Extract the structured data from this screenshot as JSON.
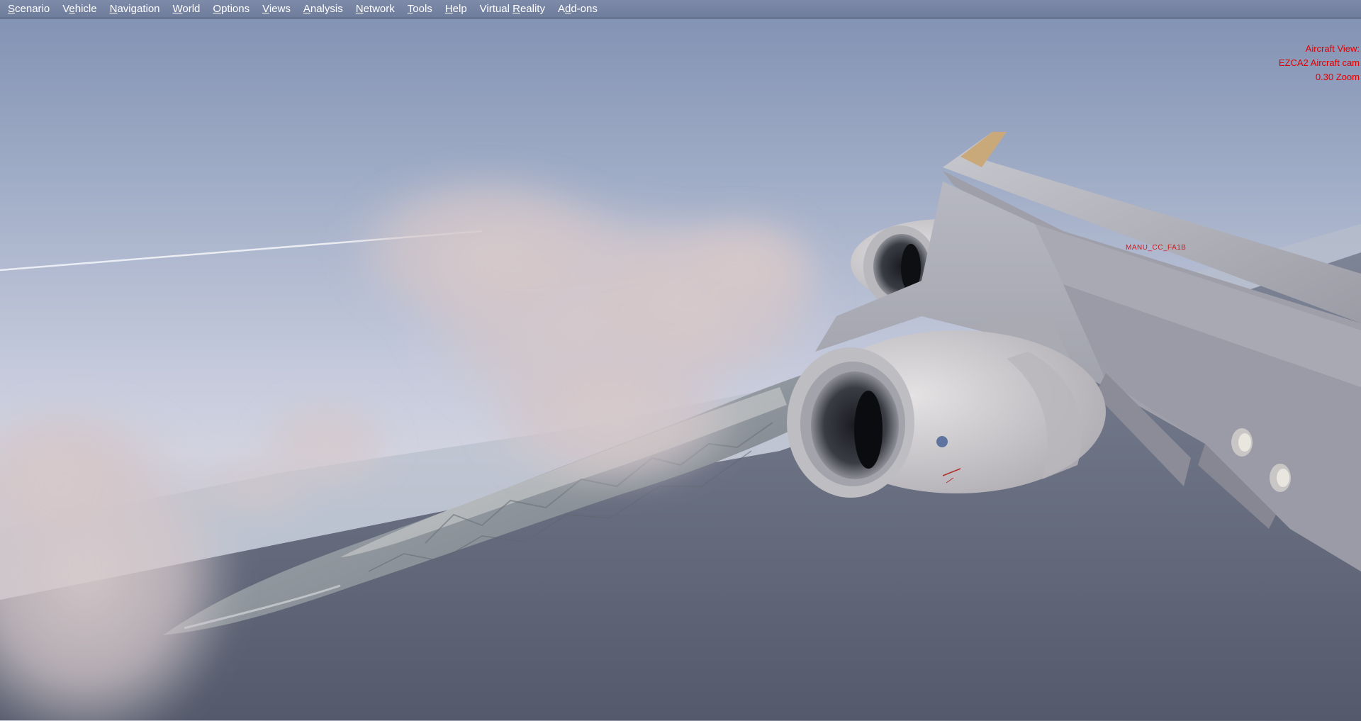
{
  "menu": {
    "items": [
      {
        "name": "scenario",
        "u": "S",
        "rest": "cenario"
      },
      {
        "name": "vehicle",
        "pre": "V",
        "u": "e",
        "rest": "hicle"
      },
      {
        "name": "navigation",
        "u": "N",
        "rest": "avigation"
      },
      {
        "name": "world",
        "u": "W",
        "rest": "orld"
      },
      {
        "name": "options",
        "u": "O",
        "rest": "ptions"
      },
      {
        "name": "views",
        "u": "V",
        "rest": "iews"
      },
      {
        "name": "analysis",
        "u": "A",
        "rest": "nalysis"
      },
      {
        "name": "network",
        "u": "N",
        "rest": "etwork"
      },
      {
        "name": "tools",
        "u": "T",
        "rest": "ools"
      },
      {
        "name": "help",
        "u": "H",
        "rest": "elp"
      },
      {
        "name": "virtual-reality",
        "pre": "Virtual ",
        "u": "R",
        "rest": "eality"
      },
      {
        "name": "add-ons",
        "pre": "A",
        "u": "d",
        "rest": "d-ons"
      }
    ]
  },
  "overlay": {
    "line1": "Aircraft View:",
    "line2": "EZCA2 Aircraft cam",
    "line3": "0.30 Zoom"
  },
  "scene": {
    "wing_label": "MANU_CC_FA1B",
    "colors": {
      "sky_top": "#8393b4",
      "horizon": "#d2d3e0",
      "ocean": "#5f6576",
      "wing": "#b4b4bc",
      "engine": "#cfcdd0",
      "overlay_text": "#e00000"
    }
  }
}
